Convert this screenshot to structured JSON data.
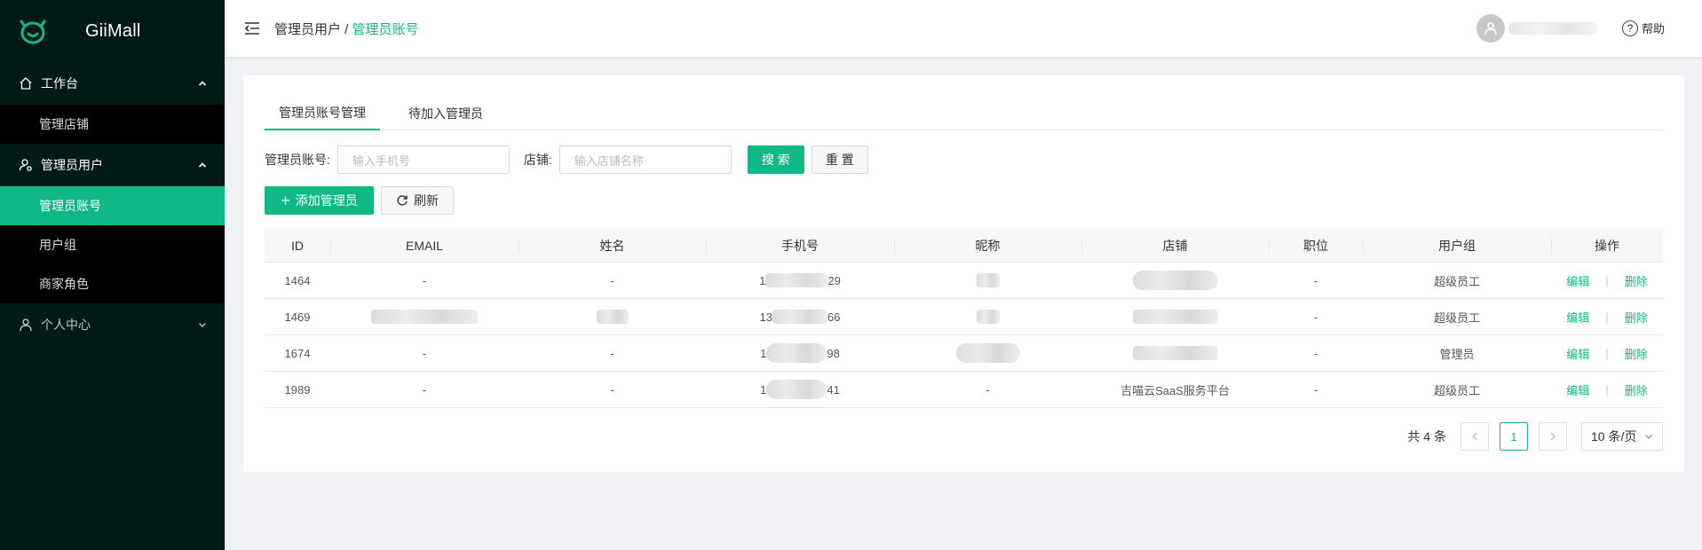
{
  "app": {
    "name": "GiiMall"
  },
  "colors": {
    "brand": "#0fb886",
    "sidebar_bg": "#001a15",
    "sidebar_sub_bg": "#000000"
  },
  "sidebar": {
    "groups": [
      {
        "label": "工作台",
        "icon": "home-icon",
        "expanded": true,
        "items": [
          {
            "label": "管理店铺"
          }
        ]
      },
      {
        "label": "管理员用户",
        "icon": "user-settings-icon",
        "expanded": true,
        "items": [
          {
            "label": "管理员账号",
            "active": true
          },
          {
            "label": "用户组"
          },
          {
            "label": "商家角色"
          }
        ]
      },
      {
        "label": "个人中心",
        "icon": "user-icon",
        "expanded": false,
        "items": []
      }
    ]
  },
  "header": {
    "breadcrumb": {
      "parent": "管理员用户 / ",
      "current": "管理员账号"
    },
    "help_label": "帮助"
  },
  "tabs": [
    {
      "label": "管理员账号管理",
      "active": true
    },
    {
      "label": "待加入管理员",
      "active": false
    }
  ],
  "filters": {
    "account_label": "管理员账号:",
    "account_placeholder": "输入手机号",
    "shop_label": "店铺:",
    "shop_placeholder": "输入店铺名称",
    "search_label": "搜 索",
    "reset_label": "重 置"
  },
  "actions": {
    "add_label": "添加管理员",
    "refresh_label": "刷新"
  },
  "table": {
    "columns": [
      "ID",
      "EMAIL",
      "姓名",
      "手机号",
      "昵称",
      "店铺",
      "职位",
      "用户组",
      "操作"
    ],
    "rows": [
      {
        "id": "1464",
        "email": "-",
        "name": "-",
        "phone_start": "1",
        "phone_end": "29",
        "shop": "",
        "position": "-",
        "group": "超级员工"
      },
      {
        "id": "1469",
        "email": "",
        "name": "",
        "phone_start": "13",
        "phone_end": "66",
        "shop": "",
        "position": "-",
        "group": "超级员工"
      },
      {
        "id": "1674",
        "email": "-",
        "name": "-",
        "phone_start": "1",
        "phone_end": "98",
        "shop": "",
        "position": "-",
        "group": "管理员"
      },
      {
        "id": "1989",
        "email": "-",
        "name": "-",
        "phone_start": "1",
        "phone_end": "41",
        "nickname": "-",
        "shop": "吉喵云SaaS服务平台",
        "position": "-",
        "group": "超级员工"
      }
    ],
    "edit_label": "编辑",
    "delete_label": "删除",
    "op_sep": "|"
  },
  "pagination": {
    "total_label": "共 4 条",
    "current_page": "1",
    "page_size_label": "10 条/页"
  }
}
